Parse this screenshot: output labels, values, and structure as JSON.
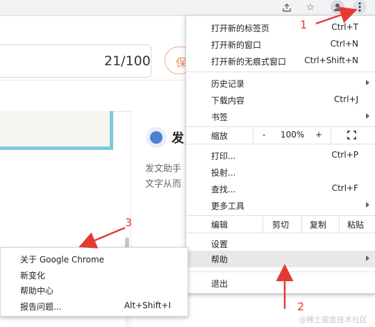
{
  "page": {
    "counter": "21/100",
    "orange_button_char": "保",
    "heading_char": "发",
    "desc_line1": "发文助手",
    "desc_line2": "文字从而",
    "watermark": "@稀土掘金技术社区"
  },
  "main_menu": {
    "new_tab": {
      "label": "打开新的标签页",
      "shortcut": "Ctrl+T"
    },
    "new_window": {
      "label": "打开新的窗口",
      "shortcut": "Ctrl+N"
    },
    "new_incognito": {
      "label": "打开新的无痕式窗口",
      "shortcut": "Ctrl+Shift+N"
    },
    "history": {
      "label": "历史记录"
    },
    "downloads": {
      "label": "下载内容",
      "shortcut": "Ctrl+J"
    },
    "bookmarks": {
      "label": "书签"
    },
    "zoom": {
      "label": "缩放",
      "minus": "-",
      "value": "100%",
      "plus": "+"
    },
    "print": {
      "label": "打印...",
      "shortcut": "Ctrl+P"
    },
    "cast": {
      "label": "投射..."
    },
    "find": {
      "label": "查找...",
      "shortcut": "Ctrl+F"
    },
    "more_tools": {
      "label": "更多工具"
    },
    "edit": {
      "label": "编辑",
      "cut": "剪切",
      "copy": "复制",
      "paste": "粘贴"
    },
    "settings": {
      "label": "设置"
    },
    "help": {
      "label": "帮助"
    },
    "exit": {
      "label": "退出"
    }
  },
  "help_submenu": {
    "about": {
      "label": "关于 Google Chrome"
    },
    "whats_new": {
      "label": "新变化"
    },
    "help_center": {
      "label": "帮助中心"
    },
    "report_issue": {
      "label": "报告问题...",
      "shortcut": "Alt+Shift+I"
    }
  },
  "annotations": {
    "n1": "1",
    "n2": "2",
    "n3": "3",
    "color": "#e53935"
  }
}
